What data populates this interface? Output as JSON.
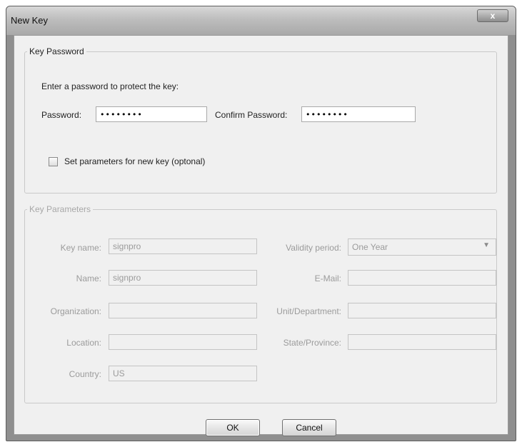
{
  "window": {
    "title": "New Key",
    "close_glyph": "x"
  },
  "key_password": {
    "legend": "Key Password",
    "prompt": "Enter a password to protect the key:",
    "password_label": "Password:",
    "password_value": "••••••••",
    "confirm_label": "Confirm Password:",
    "confirm_value": "••••••••",
    "set_params_label": "Set parameters for new key (optonal)",
    "set_params_checked": false
  },
  "key_parameters": {
    "legend": "Key Parameters",
    "enabled": false,
    "key_name_label": "Key name:",
    "key_name_value": "signpro",
    "name_label": "Name:",
    "name_value": "signpro",
    "organization_label": "Organization:",
    "organization_value": "",
    "location_label": "Location:",
    "location_value": "",
    "country_label": "Country:",
    "country_value": "US",
    "validity_label": "Validity period:",
    "validity_value": "One Year",
    "email_label": "E-Mail:",
    "email_value": "",
    "unit_label": "Unit/Department:",
    "unit_value": "",
    "state_label": "State/Province:",
    "state_value": ""
  },
  "buttons": {
    "ok_label": "OK",
    "cancel_label": "Cancel"
  },
  "icons": {
    "close": "close-icon",
    "dropdown": "chevron-down-icon"
  }
}
